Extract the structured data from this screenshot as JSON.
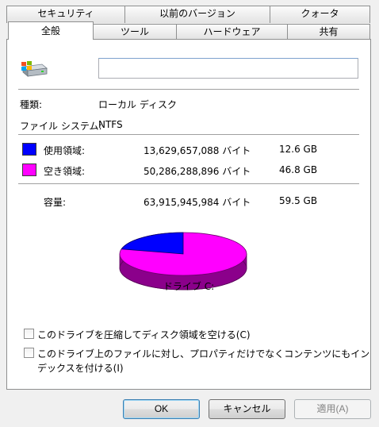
{
  "tabs_back": [
    {
      "label": "セキュリティ"
    },
    {
      "label": "以前のバージョン"
    },
    {
      "label": "クォータ"
    }
  ],
  "tabs_front": [
    {
      "label": "全般",
      "active": true
    },
    {
      "label": "ツール"
    },
    {
      "label": "ハードウェア"
    },
    {
      "label": "共有"
    }
  ],
  "general": {
    "drive_icon": "drive-icon",
    "name_value": "",
    "type_label": "種類:",
    "type_value": "ローカル ディスク",
    "fs_label": "ファイル システム:",
    "fs_value": "NTFS"
  },
  "space": {
    "used": {
      "label": "使用領域:",
      "bytes": "13,629,657,088 バイト",
      "size": "12.6 GB",
      "color": "#0000ff"
    },
    "free": {
      "label": "空き領域:",
      "bytes": "50,286,288,896 バイト",
      "size": "46.8 GB",
      "color": "#ff00ff"
    },
    "capacity": {
      "label": "容量:",
      "bytes": "63,915,945,984 バイト",
      "size": "59.5 GB"
    }
  },
  "pie": {
    "used_fraction": 0.2132,
    "used_color": "#0000ff",
    "free_color": "#ff00ff"
  },
  "drive_label": "ドライブ C:",
  "options": {
    "compress_label": "このドライブを圧縮してディスク領域を空ける(C)",
    "compress_checked": false,
    "index_label_line1": "このドライブ上のファイルに対し、プロパティだけでなくコンテンツにもイン",
    "index_label_line2": "デックスを付ける(I)",
    "index_checked": false
  },
  "buttons": {
    "ok": "OK",
    "cancel": "キャンセル",
    "apply": "適用(A)"
  }
}
